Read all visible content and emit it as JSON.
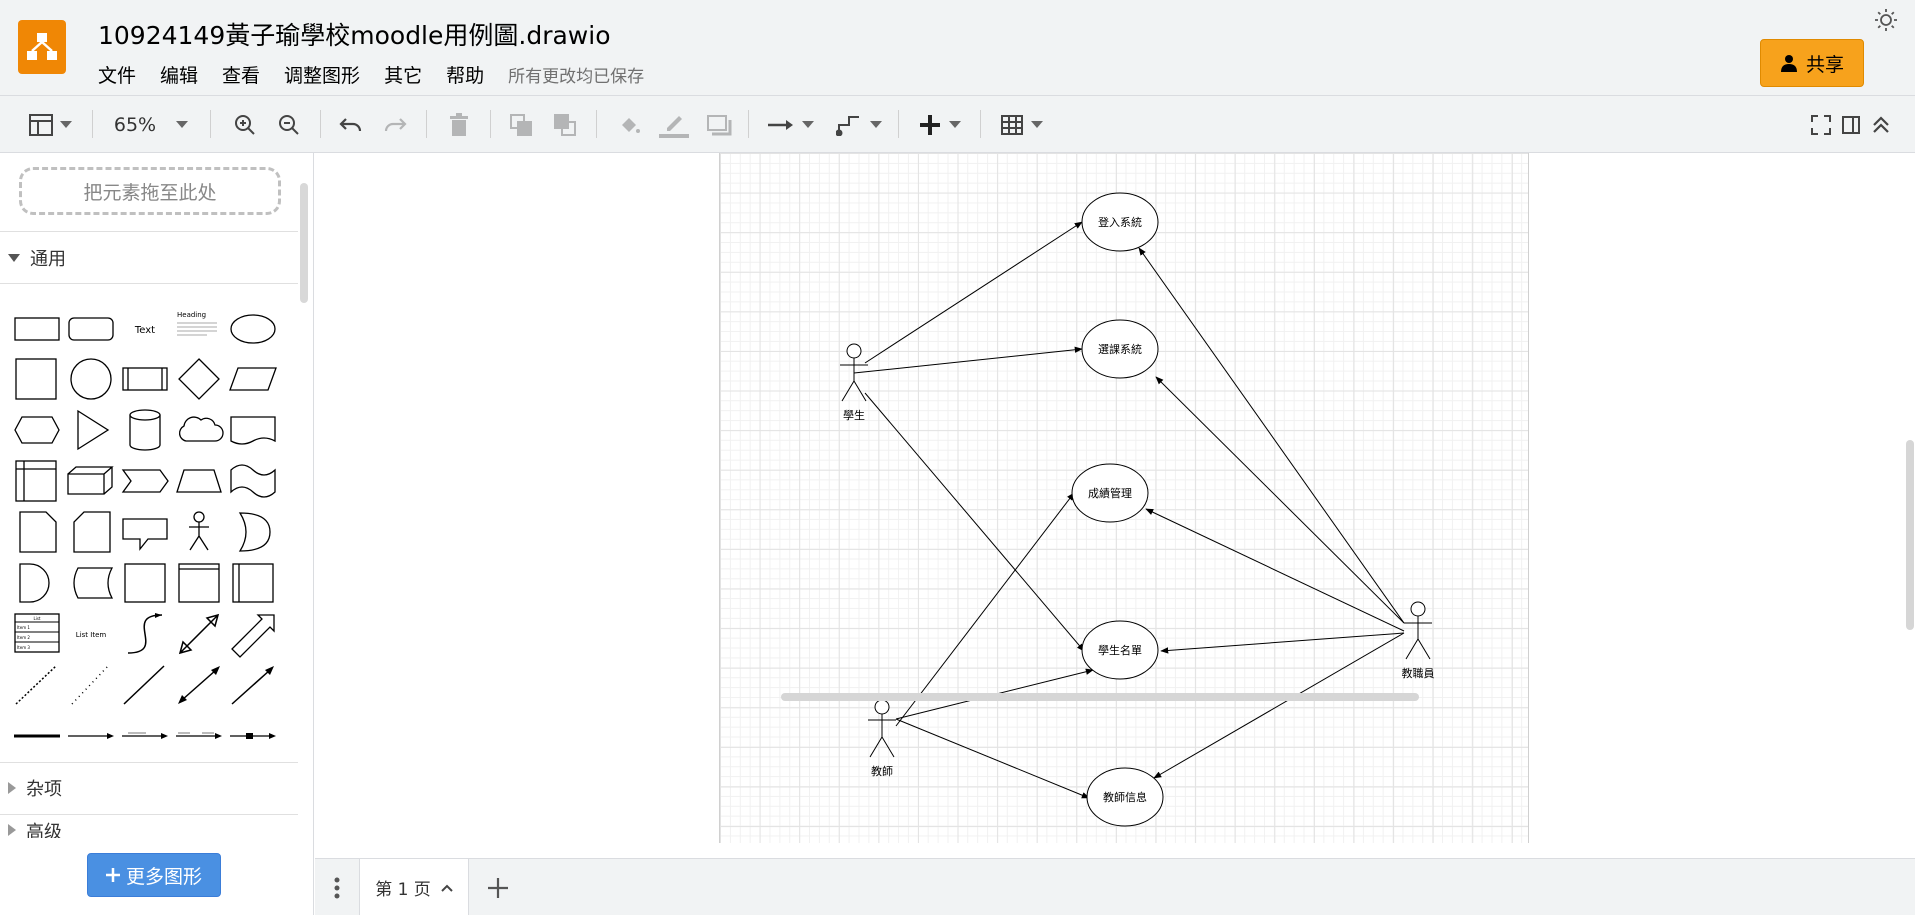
{
  "header": {
    "title": "10924149黃子瑜學校moodle用例圖.drawio",
    "menu": [
      "文件",
      "编辑",
      "查看",
      "调整图形",
      "其它",
      "帮助"
    ],
    "save_status": "所有更改均已保存",
    "share_label": "共享"
  },
  "toolbar": {
    "zoom": "65%"
  },
  "sidebar": {
    "drop_zone": "把元素拖至此处",
    "sections": [
      {
        "label": "通用",
        "expanded": true
      },
      {
        "label": "杂项",
        "expanded": false
      },
      {
        "label": "高级",
        "expanded": false
      }
    ],
    "shape_text": {
      "text": "Text",
      "heading": "Heading",
      "list_item": "List Item",
      "list": "List",
      "item1": "Item 1",
      "item2": "Item 2",
      "item3": "Item 3"
    },
    "more_shapes": "更多图形"
  },
  "diagram": {
    "use_cases": [
      "登入系統",
      "選課系統",
      "成績管理",
      "學生名單",
      "教師信息"
    ],
    "actors": [
      "學生",
      "教師",
      "教職員"
    ]
  },
  "footer": {
    "page_tab": "第 1 页"
  },
  "colors": {
    "accent": "#f08705",
    "share": "#f7a21c",
    "more_shapes": "#4a90e2",
    "chrome": "#f1f3f4"
  }
}
